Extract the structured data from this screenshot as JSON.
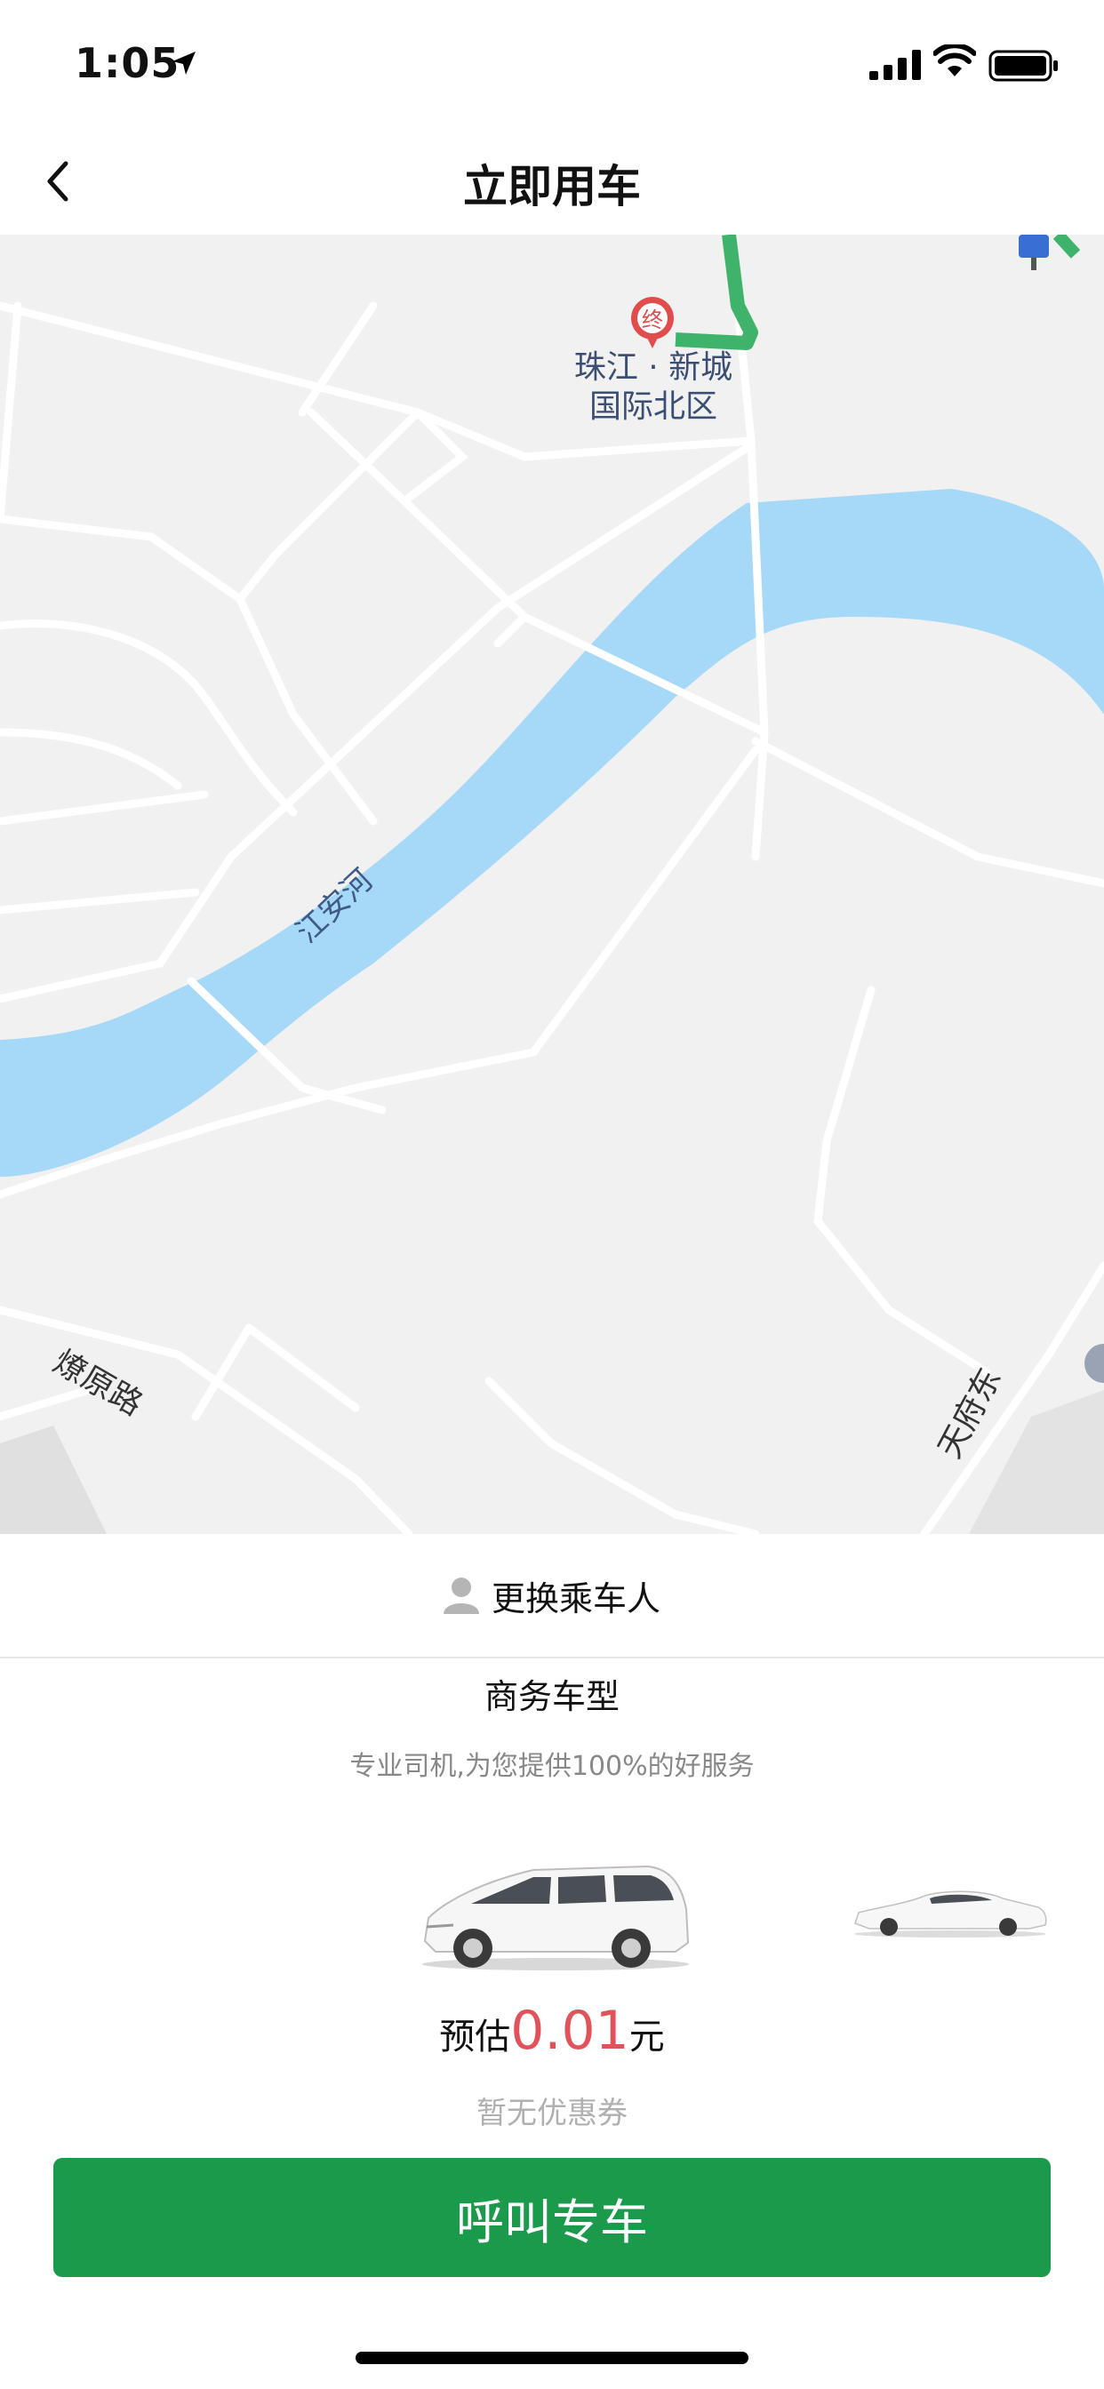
{
  "status_bar": {
    "time": "1:05"
  },
  "nav": {
    "title": "立即用车"
  },
  "map": {
    "destination_marker": "终",
    "destination_line1": "珠江 · 新城",
    "destination_line2": "国际北区",
    "river_name": "江安河",
    "road_name_1": "燎原路",
    "road_name_2": "天府东"
  },
  "passenger": {
    "label": "更换乘车人"
  },
  "car_type": {
    "name": "商务车型",
    "subtitle": "专业司机,为您提供100%的好服务"
  },
  "price": {
    "prefix": "预估",
    "amount": "0.01",
    "unit": "元"
  },
  "coupon": {
    "text": "暂无优惠券"
  },
  "action": {
    "call_label": "呼叫专车"
  },
  "colors": {
    "accent_green": "#1b9a4c",
    "price_red": "#e0535a",
    "river_blue": "#a6d8f8"
  }
}
